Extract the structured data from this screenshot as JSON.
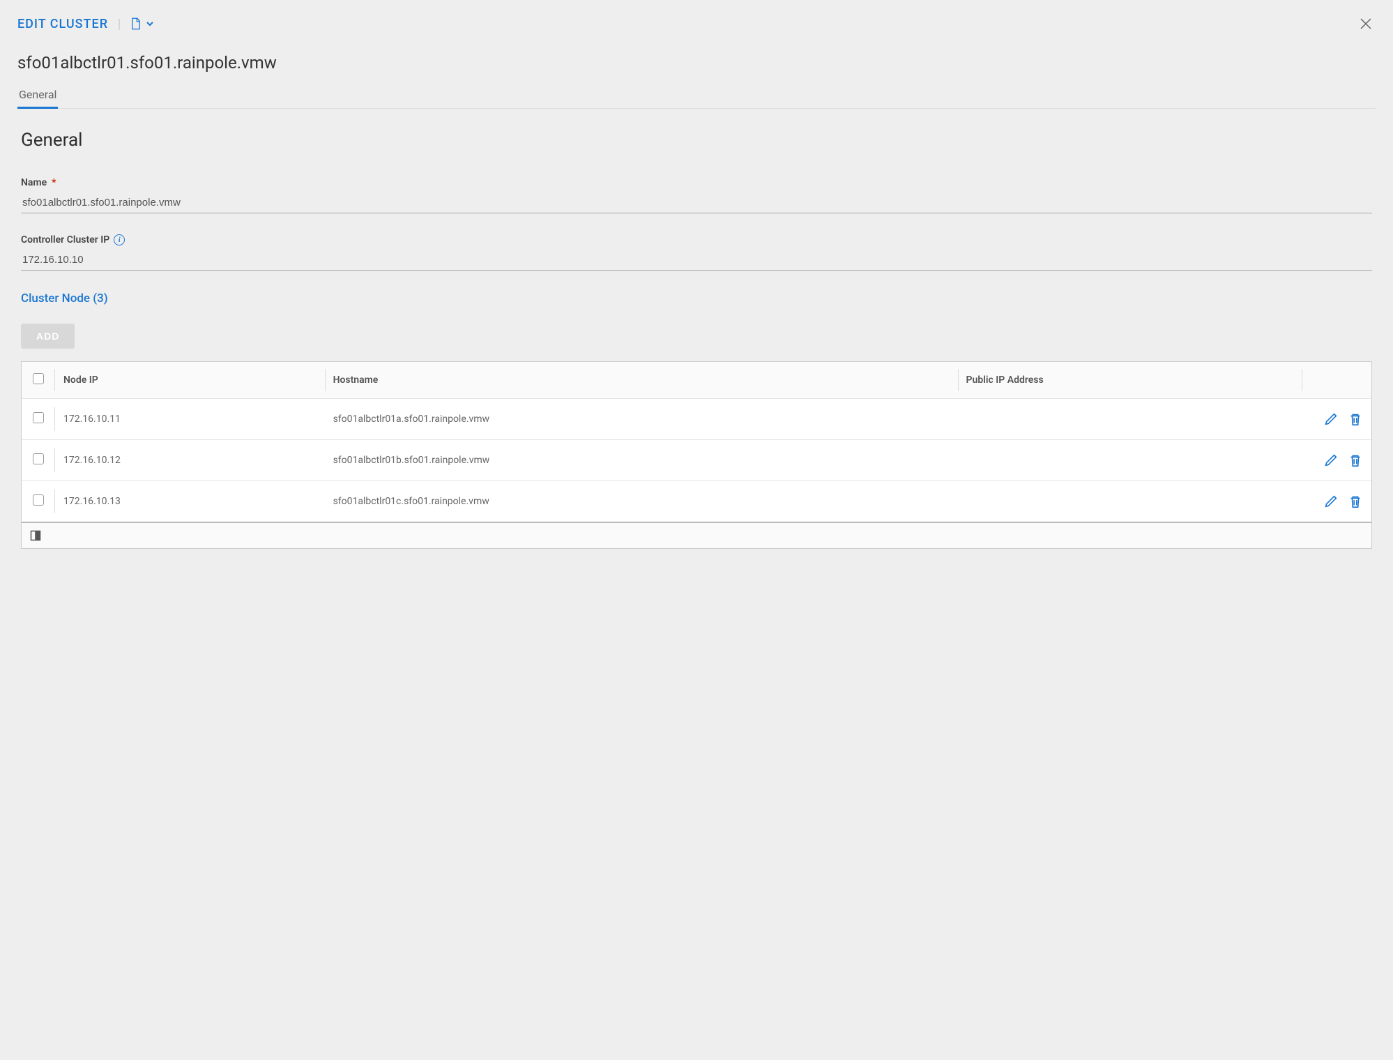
{
  "header": {
    "breadcrumb_title": "EDIT CLUSTER",
    "cluster_name": "sfo01albctlr01.sfo01.rainpole.vmw"
  },
  "tabs": {
    "general": "General"
  },
  "section": {
    "title": "General"
  },
  "fields": {
    "name_label": "Name",
    "name_value": "sfo01albctlr01.sfo01.rainpole.vmw",
    "cluster_ip_label": "Controller Cluster IP",
    "cluster_ip_value": "172.16.10.10"
  },
  "nodes": {
    "subsection_label": "Cluster Node (3)",
    "add_button": "ADD",
    "columns": {
      "node_ip": "Node IP",
      "hostname": "Hostname",
      "public_ip": "Public IP Address"
    },
    "rows": [
      {
        "node_ip": "172.16.10.11",
        "hostname": "sfo01albctlr01a.sfo01.rainpole.vmw",
        "public_ip": ""
      },
      {
        "node_ip": "172.16.10.12",
        "hostname": "sfo01albctlr01b.sfo01.rainpole.vmw",
        "public_ip": ""
      },
      {
        "node_ip": "172.16.10.13",
        "hostname": "sfo01albctlr01c.sfo01.rainpole.vmw",
        "public_ip": ""
      }
    ]
  }
}
